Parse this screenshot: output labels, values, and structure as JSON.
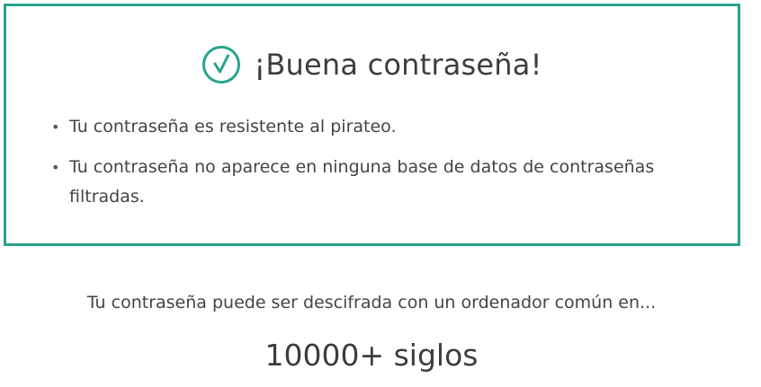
{
  "result": {
    "title": "¡Buena contraseña!",
    "icon": "check-circle-icon",
    "accent_color": "#29a38d",
    "bullets": [
      "Tu contraseña es resistente al pirateo.",
      "Tu contraseña no aparece en ninguna base de datos de contraseñas filtradas."
    ]
  },
  "crack_time": {
    "label": "Tu contraseña puede ser descifrada con un ordenador común en...",
    "value": "10000+ siglos"
  }
}
